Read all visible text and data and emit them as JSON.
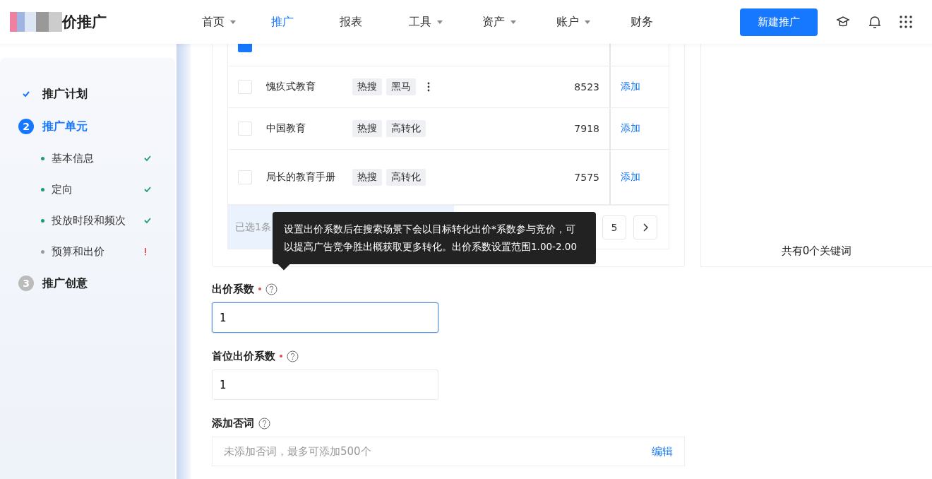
{
  "header": {
    "logo_text": "价推广",
    "menu": [
      {
        "label": "首页",
        "dropdown": true,
        "selected": false
      },
      {
        "label": "推广",
        "dropdown": false,
        "selected": true
      },
      {
        "label": "报表",
        "dropdown": false,
        "selected": false
      },
      {
        "label": "工具",
        "dropdown": true,
        "selected": false
      },
      {
        "label": "资产",
        "dropdown": true,
        "selected": false
      },
      {
        "label": "账户",
        "dropdown": true,
        "selected": false
      },
      {
        "label": "财务",
        "dropdown": false,
        "selected": false
      }
    ],
    "create_button": "新建推广"
  },
  "steps": [
    {
      "kind": "done",
      "label": "推广计划"
    },
    {
      "kind": "active",
      "number": "2",
      "label": "推广单元",
      "children": [
        {
          "label": "基本信息",
          "kind": "done"
        },
        {
          "label": "定向",
          "kind": "done"
        },
        {
          "label": "投放时段和频次",
          "kind": "done"
        },
        {
          "label": "预算和出价",
          "kind": "error"
        }
      ]
    },
    {
      "kind": "pending",
      "number": "3",
      "label": "推广创意"
    }
  ],
  "keyword_table": {
    "rows": [
      {
        "checked": true,
        "keyword": "",
        "tags": [],
        "more": false,
        "count": "",
        "action": ""
      },
      {
        "checked": false,
        "keyword": "愧疚式教育",
        "tags": [
          "热搜",
          "黑马"
        ],
        "more": true,
        "count": "8523",
        "action": "添加"
      },
      {
        "checked": false,
        "keyword": "中国教育",
        "tags": [
          "热搜",
          "高转化"
        ],
        "more": false,
        "count": "7918",
        "action": "添加"
      },
      {
        "checked": false,
        "keyword": "局长的教育手册",
        "tags": [
          "热搜",
          "高转化"
        ],
        "more": false,
        "count": "7575",
        "action": "添加"
      }
    ],
    "selected_text": "已选1条",
    "page": "5"
  },
  "summary": "共有0个关键词",
  "tooltip": "设置出价系数后在搜索场景下会以目标转化出价*系数参与竞价，可以提高广告竞争胜出概获取更多转化。出价系数设置范围1.00-2.00",
  "fields": [
    {
      "kind": "input",
      "label": "出价系数",
      "required": true,
      "value": "1",
      "focused": true
    },
    {
      "kind": "input",
      "label": "首位出价系数",
      "required": true,
      "value": "1",
      "focused": false
    },
    {
      "kind": "words",
      "label": "添加否词",
      "required": false,
      "placeholder": "未添加否词，最多可添加500个",
      "action": "编辑"
    }
  ]
}
